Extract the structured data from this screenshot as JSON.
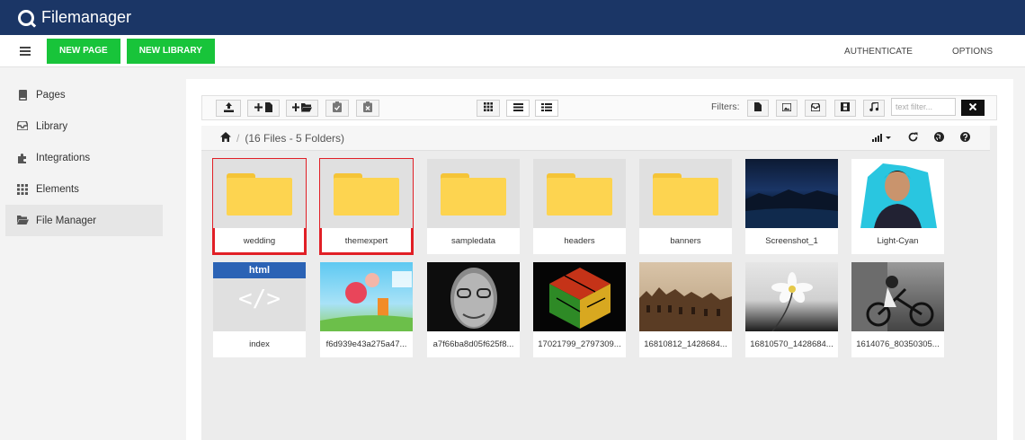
{
  "app": {
    "title": "Filemanager"
  },
  "toolbar": {
    "new_page": "NEW PAGE",
    "new_library": "NEW LIBRARY",
    "authenticate": "AUTHENTICATE",
    "options": "OPTIONS"
  },
  "sidebar": {
    "items": [
      {
        "label": "Pages",
        "icon": "book-icon"
      },
      {
        "label": "Library",
        "icon": "inbox-icon"
      },
      {
        "label": "Integrations",
        "icon": "puzzle-icon"
      },
      {
        "label": "Elements",
        "icon": "grid-icon"
      },
      {
        "label": "File Manager",
        "icon": "folder-open-icon",
        "active": true
      }
    ]
  },
  "filemanager": {
    "filters_label": "Filters:",
    "text_filter_placeholder": "text filter...",
    "summary": "(16 Files - 5 Folders)",
    "items": [
      {
        "name": "wedding",
        "type": "folder",
        "selected": true
      },
      {
        "name": "themexpert",
        "type": "folder",
        "selected": true
      },
      {
        "name": "sampledata",
        "type": "folder"
      },
      {
        "name": "headers",
        "type": "folder"
      },
      {
        "name": "banners",
        "type": "folder"
      },
      {
        "name": "Screenshot_1",
        "type": "image"
      },
      {
        "name": "Light-Cyan",
        "type": "image"
      },
      {
        "name": "index",
        "type": "html",
        "badge": "html",
        "code": "</>"
      },
      {
        "name": "f6d939e43a275a47...",
        "type": "image"
      },
      {
        "name": "a7f66ba8d05f625f8...",
        "type": "image"
      },
      {
        "name": "17021799_2797309...",
        "type": "image"
      },
      {
        "name": "16810812_1428684...",
        "type": "image"
      },
      {
        "name": "16810570_1428684...",
        "type": "image"
      },
      {
        "name": "1614076_80350305...",
        "type": "image"
      }
    ]
  },
  "colors": {
    "topbar": "#1b3666",
    "green": "#18c43a",
    "selection": "#e11f26",
    "folder": "#fdd450"
  }
}
